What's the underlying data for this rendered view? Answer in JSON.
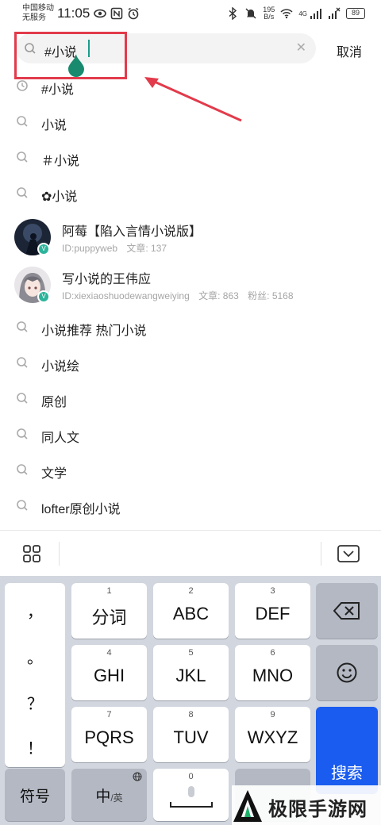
{
  "status_bar": {
    "carrier_line1": "中国移动",
    "carrier_line2": "无服务",
    "time": "11:05",
    "net_speed_value": "195",
    "net_speed_unit": "B/s",
    "network_badge": "4G",
    "battery": "89"
  },
  "search": {
    "query": "#小说",
    "cancel_label": "取消"
  },
  "suggestions_top": [
    {
      "text": "#小说",
      "icon": "clock-icon"
    },
    {
      "text": "小说",
      "icon": "search-icon"
    },
    {
      "text": "＃小说",
      "icon": "search-icon"
    },
    {
      "text": "✿小说",
      "icon": "search-icon"
    }
  ],
  "users": [
    {
      "name": "阿莓【陷入言情小说版】",
      "id": "ID:puppyweb",
      "articles": "文章: 137",
      "fans": ""
    },
    {
      "name": "写小说的王伟应",
      "id": "ID:xiexiaoshuodewangweiying",
      "articles": "文章: 863",
      "fans": "粉丝: 5168"
    }
  ],
  "suggestions_bottom": [
    {
      "text": "小说推荐 热门小说"
    },
    {
      "text": "小说绘"
    },
    {
      "text": "原创"
    },
    {
      "text": "同人文"
    },
    {
      "text": "文学"
    },
    {
      "text": "lofter原创小说"
    }
  ],
  "keyboard": {
    "punctuation": [
      "，",
      "。",
      "？",
      "！"
    ],
    "keys": [
      {
        "num": "1",
        "label": "分词"
      },
      {
        "num": "2",
        "label": "ABC"
      },
      {
        "num": "3",
        "label": "DEF"
      },
      {
        "num": "4",
        "label": "GHI"
      },
      {
        "num": "5",
        "label": "JKL"
      },
      {
        "num": "6",
        "label": "MNO"
      },
      {
        "num": "7",
        "label": "PQRS"
      },
      {
        "num": "8",
        "label": "TUV"
      },
      {
        "num": "9",
        "label": "WXYZ"
      }
    ],
    "symbols_label": "符号",
    "lang_main": "中",
    "lang_sub": "/英",
    "space_num": "0",
    "search_label": "搜索",
    "accent_color": "#1a5cf0"
  },
  "watermark": {
    "text": "极限手游网"
  }
}
